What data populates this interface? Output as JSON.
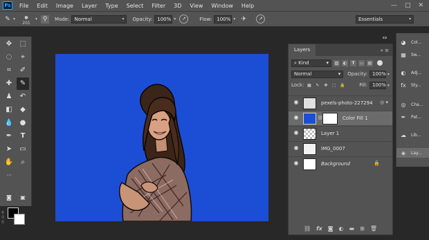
{
  "menubar": {
    "logo": "Ps",
    "items": [
      "File",
      "Edit",
      "Image",
      "Layer",
      "Type",
      "Select",
      "Filter",
      "3D",
      "View",
      "Window",
      "Help"
    ],
    "window_controls": [
      "—",
      "□",
      "✕"
    ]
  },
  "options": {
    "brush_size": "201",
    "mode_label": "Mode:",
    "mode_value": "Normal",
    "opacity_label": "Opacity:",
    "opacity_value": "100%",
    "flow_label": "Flow:",
    "flow_value": "100%",
    "workspace": "Essentials"
  },
  "ruler": {
    "numbers": "6\n0\n0"
  },
  "layers_panel": {
    "tab": "Layers",
    "menu_controls": "»  ≡",
    "filter_kind": "Kind",
    "blend_mode": "Normal",
    "opacity_label": "Opacity:",
    "opacity_value": "100%",
    "lock_label": "Lock:",
    "fill_label": "Fill:",
    "fill_value": "100%",
    "layers": [
      {
        "name": "pexels-photo-227294",
        "selected": false
      },
      {
        "name": "Color Fill 1",
        "selected": true
      },
      {
        "name": "Layer 1",
        "selected": false
      },
      {
        "name": "IMG_0007",
        "selected": false
      },
      {
        "name": "Background",
        "selected": false
      }
    ],
    "footer_icons": [
      "link-icon",
      "fx-icon",
      "mask-icon",
      "adjustment-icon",
      "folder-icon",
      "new-layer-icon",
      "trash-icon"
    ],
    "footer_fx": "fx"
  },
  "right_dock": {
    "items": [
      {
        "label": "Col..."
      },
      {
        "label": "Sw..."
      },
      {
        "label": "Adj..."
      },
      {
        "label": "Sty..."
      },
      {
        "label": "Cha..."
      },
      {
        "label": "Pat..."
      },
      {
        "label": "Lib..."
      },
      {
        "label": "Lay..."
      }
    ]
  },
  "colors": {
    "canvas_fill": "#1c4ed5",
    "foreground": "#000000",
    "background": "#ffffff",
    "ps_blue": "#31a8ff"
  }
}
